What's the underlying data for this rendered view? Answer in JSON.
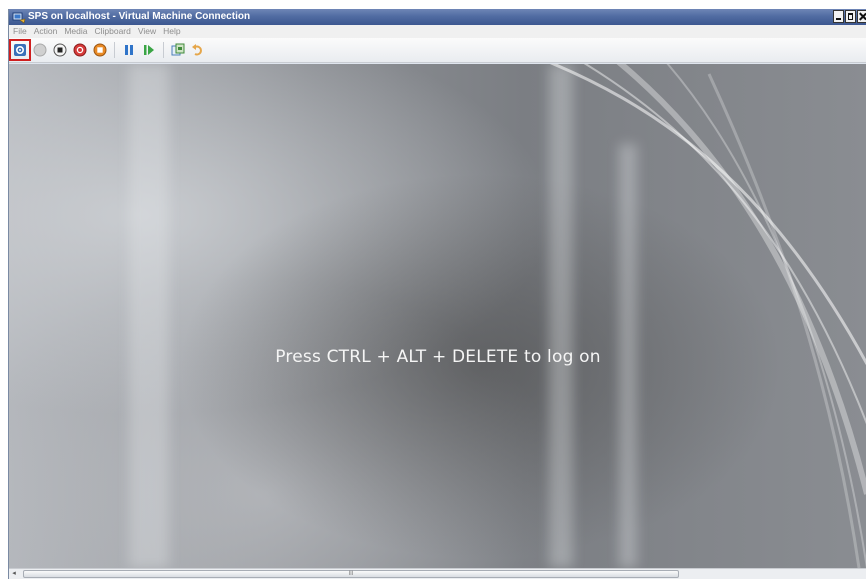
{
  "window": {
    "title": "SPS on localhost - Virtual Machine Connection",
    "controls": [
      "minimize",
      "maximize",
      "close"
    ]
  },
  "menu": {
    "items": [
      "File",
      "Action",
      "Media",
      "Clipboard",
      "View",
      "Help"
    ]
  },
  "toolbar": {
    "buttons": [
      {
        "icon": "ctrl-alt-del-icon",
        "selected": true
      },
      {
        "icon": "start-icon"
      },
      {
        "icon": "turn-off-icon"
      },
      {
        "icon": "shut-down-icon"
      },
      {
        "icon": "save-state-icon"
      },
      {
        "icon": "pause-icon"
      },
      {
        "icon": "reset-icon"
      },
      {
        "icon": "snapshot-icon"
      },
      {
        "icon": "revert-icon"
      }
    ]
  },
  "screen": {
    "message": "Press CTRL + ALT + DELETE to log on"
  },
  "scrollbar": {
    "left_arrow": "◂",
    "grip": "III"
  },
  "colors": {
    "titlebar": "#4b65a0",
    "selection_outline": "#cf1f1f",
    "screen_bg": "#8d9095"
  }
}
